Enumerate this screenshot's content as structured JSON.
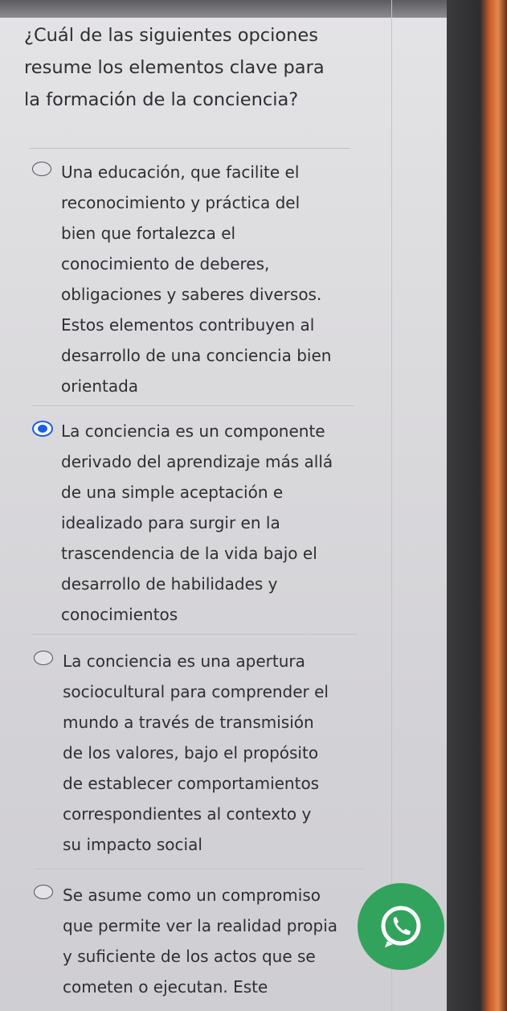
{
  "question": {
    "text": "¿Cuál de las siguientes opciones\nresume los elementos clave para\nla formación de la conciencia?"
  },
  "options": [
    {
      "text": "Una educación, que facilite el\nreconocimiento y práctica del\nbien que fortalezca el\nconocimiento de deberes,\nobligaciones y saberes diversos.\nEstos elementos contribuyen al\ndesarrollo de una conciencia bien\norientada",
      "selected": false
    },
    {
      "text": "La conciencia es un componente\nderivado del aprendizaje más allá\nde una simple aceptación e\nidealizado para surgir en la\ntrascendencia de la vida bajo el\ndesarrollo de habilidades y\nconocimientos",
      "selected": true
    },
    {
      "text": "La conciencia es una apertura\nsociocultural para comprender el\nmundo a través de transmisión\nde los valores, bajo el propósito\nde establecer comportamientos\ncorrespondientes al contexto y\nsu impacto social",
      "selected": false
    },
    {
      "text": "Se asume como un compromiso\nque permite ver la realidad propia\ny suficiente de los actos que se\ncometen o ejecutan. Este",
      "selected": false
    }
  ],
  "floating_badge": {
    "icon": "whatsapp-icon",
    "color": "#32a35c"
  },
  "colors": {
    "text": "#2f2e33",
    "radio_selected": "#1b5fe0",
    "background": "#dbdadd"
  }
}
